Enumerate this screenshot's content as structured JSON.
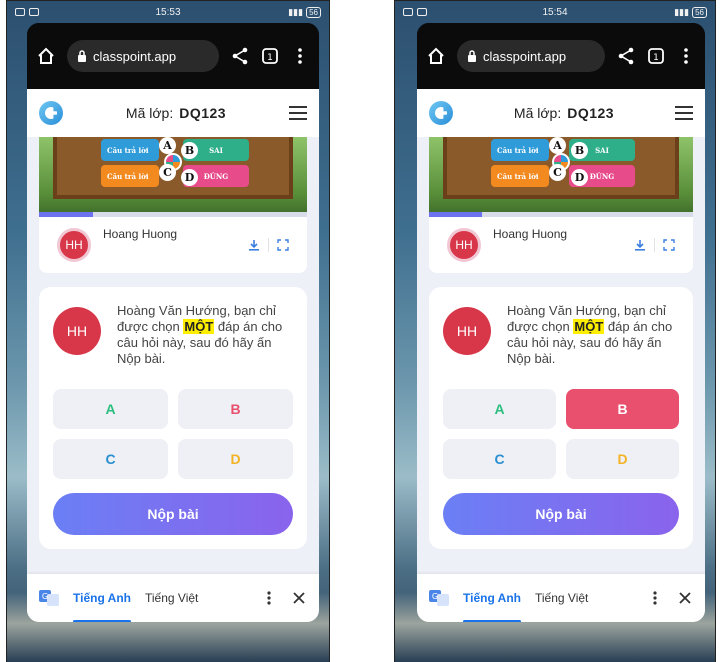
{
  "screens": [
    {
      "status": {
        "time": "15:53",
        "battery": "56"
      },
      "browser": {
        "url": "classpoint.app"
      },
      "header": {
        "label": "Mã lớp:",
        "code": "DQ123"
      },
      "slide": {
        "answer_small": "Câu trả lời",
        "answer_sai": "SAI",
        "answer_dung": "ĐÚNG",
        "letters": [
          "A",
          "B",
          "C",
          "D"
        ],
        "progress": 0.2
      },
      "user": {
        "initials": "HH",
        "name": "Hoang Huong"
      },
      "question": {
        "initials": "HH",
        "text_before": "Hoàng Văn Hướng, bạn chỉ được chọn ",
        "highlight": "MỘT",
        "text_after": " đáp án cho câu hỏi này, sau đó hãy ấn Nộp bài."
      },
      "choices": [
        {
          "label": "A",
          "color": "#2bbf7f",
          "selected": false
        },
        {
          "label": "B",
          "color": "#e8506e",
          "selected": false
        },
        {
          "label": "C",
          "color": "#2a8fd0",
          "selected": false
        },
        {
          "label": "D",
          "color": "#f4b324",
          "selected": false
        }
      ],
      "submit_label": "Nộp bài",
      "translate": {
        "lang_active": "Tiếng Anh",
        "lang_other": "Tiếng Việt"
      }
    },
    {
      "status": {
        "time": "15:54",
        "battery": "56"
      },
      "browser": {
        "url": "classpoint.app"
      },
      "header": {
        "label": "Mã lớp:",
        "code": "DQ123"
      },
      "slide": {
        "answer_small": "Câu trả lời",
        "answer_sai": "SAI",
        "answer_dung": "ĐÚNG",
        "letters": [
          "A",
          "B",
          "C",
          "D"
        ],
        "progress": 0.2
      },
      "user": {
        "initials": "HH",
        "name": "Hoang Huong"
      },
      "question": {
        "initials": "HH",
        "text_before": "Hoàng Văn Hướng, bạn chỉ được chọn ",
        "highlight": "MỘT",
        "text_after": " đáp án cho câu hỏi này, sau đó hãy ấn Nộp bài."
      },
      "choices": [
        {
          "label": "A",
          "color": "#2bbf7f",
          "selected": false
        },
        {
          "label": "B",
          "color": "#e8506e",
          "selected": true
        },
        {
          "label": "C",
          "color": "#2a8fd0",
          "selected": false
        },
        {
          "label": "D",
          "color": "#f4b324",
          "selected": false
        }
      ],
      "submit_label": "Nộp bài",
      "translate": {
        "lang_active": "Tiếng Anh",
        "lang_other": "Tiếng Việt"
      }
    }
  ]
}
